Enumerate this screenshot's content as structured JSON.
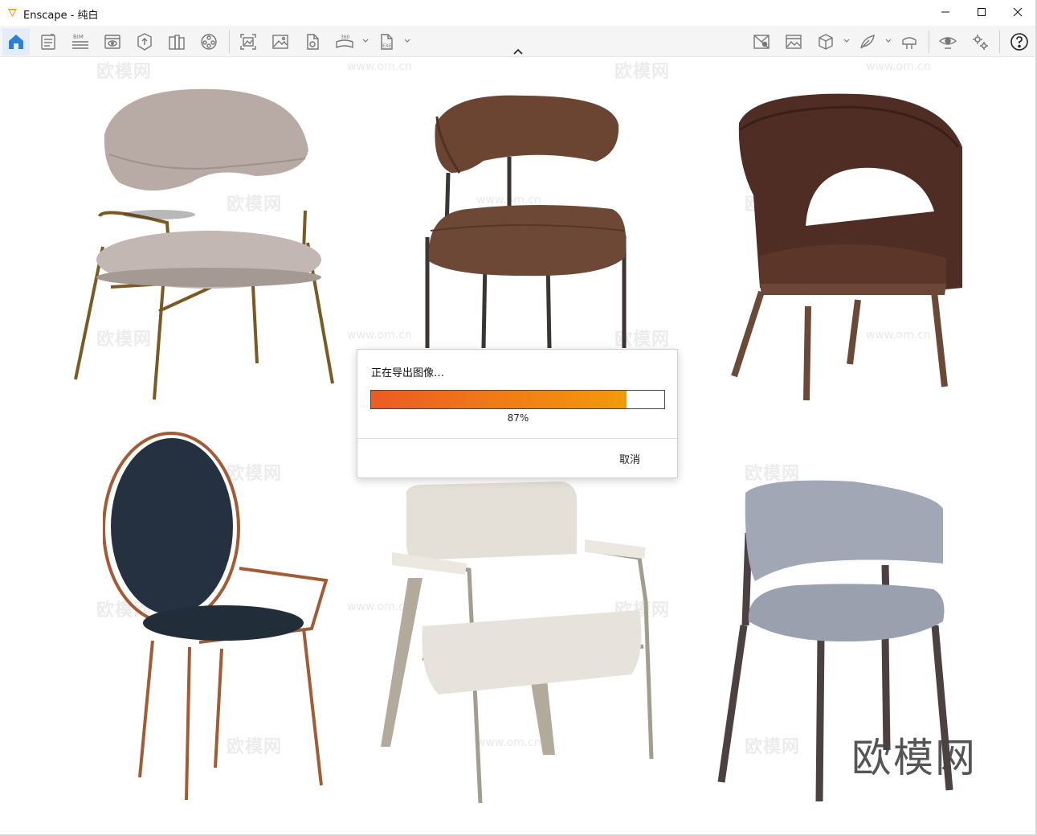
{
  "window": {
    "app_name": "Enscape",
    "title": "Enscape - 纯白",
    "controls": [
      "minimize-icon",
      "maximize-icon",
      "close-icon"
    ]
  },
  "toolbar": {
    "left_icons": [
      "home-icon",
      "document-icon",
      "bim-icon",
      "view-icon",
      "asset-icon",
      "library-icon",
      "video-icon",
      "screenshot-icon",
      "image-icon",
      "file-export-icon",
      "panorama-360-icon",
      "exe-export-icon"
    ],
    "right_icons": [
      "map-icon",
      "material-icon",
      "cube-icon",
      "feather-icon",
      "vr-headset-icon",
      "eye-visibility-icon",
      "settings-icon",
      "help-icon"
    ],
    "bim_label": "BIM",
    "panorama_label": "360",
    "exe_label": "EXE",
    "collapse_icon": "chevron-up-icon"
  },
  "viewport": {
    "watermark_brand": "欧模网",
    "watermark_url": "www.om.cn"
  },
  "dialog": {
    "title": "正在导出图像…",
    "progress_percent": 87,
    "progress_label": "87%",
    "cancel_label": "取消",
    "progress_colors": [
      "#ec5b24",
      "#f39a0a"
    ]
  },
  "colors": {
    "accent": "#1a73c9",
    "toolbar_bg": "#f5f5f5"
  }
}
